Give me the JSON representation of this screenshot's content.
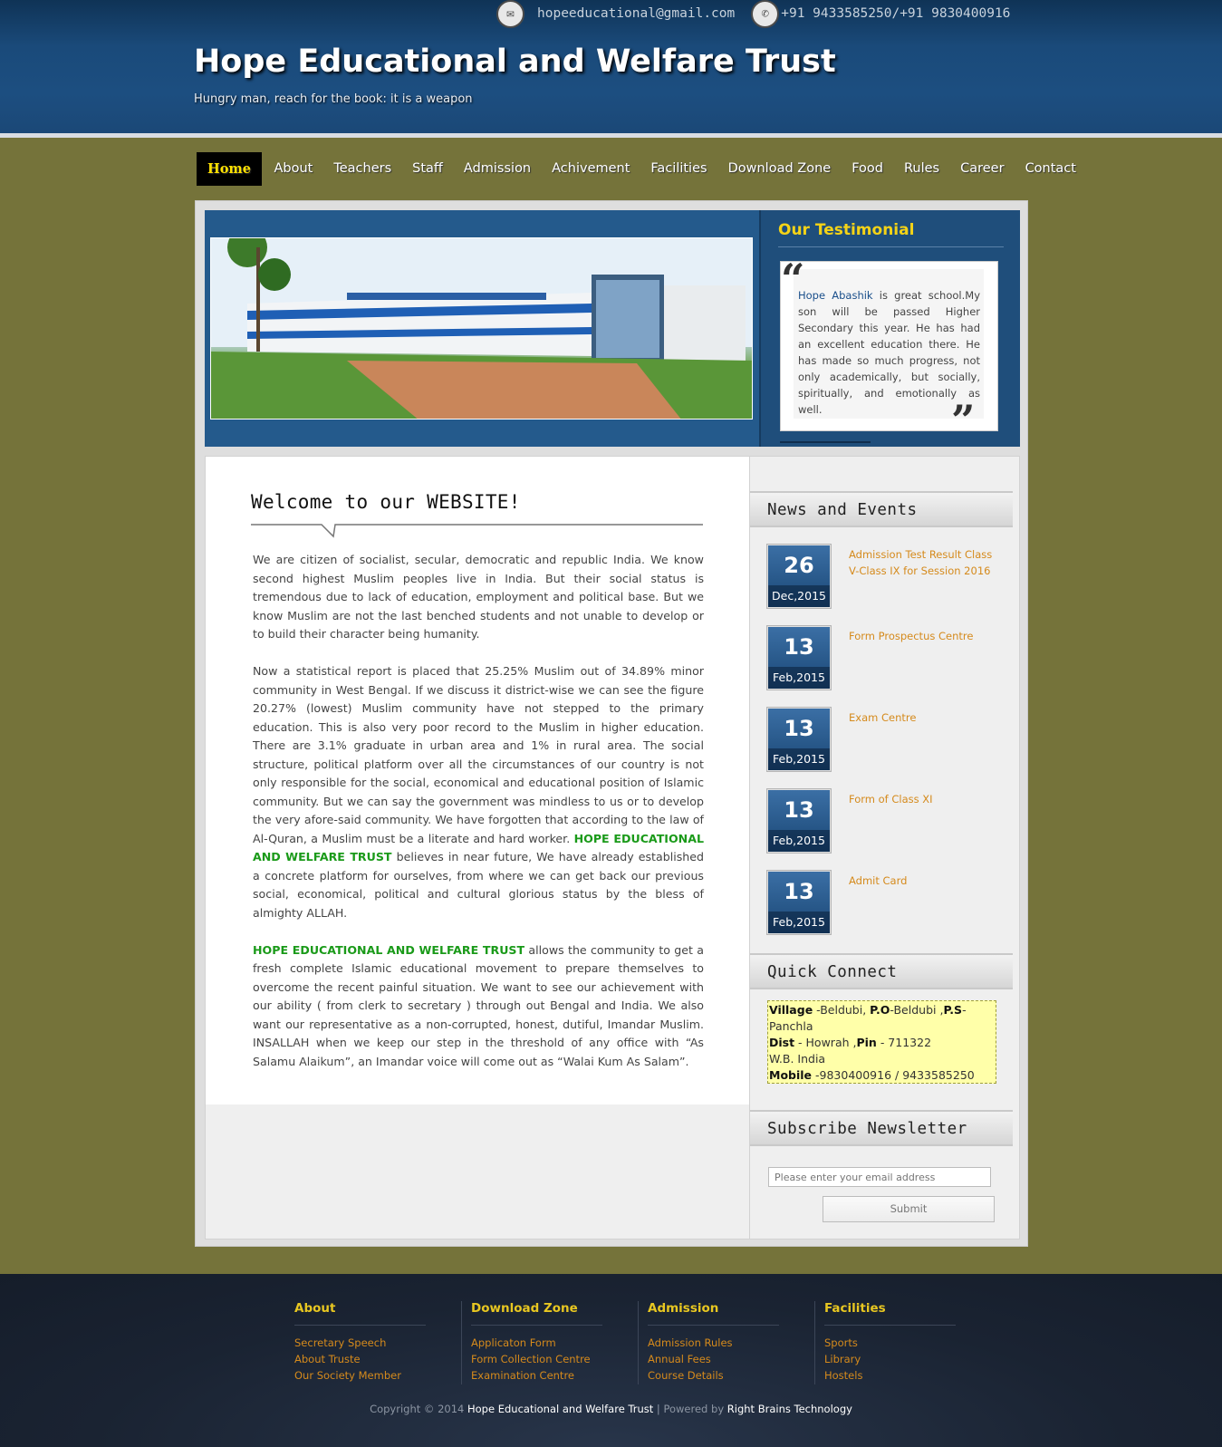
{
  "header": {
    "email": "hopeeducational@gmail.com",
    "phone": "+91 9433585250/+91 9830400916",
    "title": "Hope Educational and Welfare Trust",
    "tagline": "Hungry man, reach for the book: it is a weapon",
    "email_icon": "envelope-icon",
    "phone_icon": "phone-icon"
  },
  "nav": [
    "Home",
    "About",
    "Teachers",
    "Staff",
    "Admission",
    "Achivement",
    "Facilities",
    "Download Zone",
    "Food",
    "Rules",
    "Career",
    "Contact"
  ],
  "testimonial": {
    "title": "Our Testimonial",
    "name": "Hope Abashik",
    "text": " is great school.My son will be passed Higher Secondary this year. He has had an excellent education there. He has made so much progress, not only academically, but socially, spiritually, and emotionally as well."
  },
  "article": {
    "title": "Welcome to our WEBSITE!",
    "p1": "We are citizen of socialist, secular, democratic and republic India. We know second highest Muslim peoples live in India. But their social status is tremendous due to lack of education, employment and political base. But we know Muslim are not the last benched students and not unable to develop or to build their character being humanity.",
    "p2a": "Now a statistical report is placed that 25.25% Muslim out of 34.89% minor community in West Bengal. If we discuss it district-wise we can see the figure 20.27% (lowest) Muslim community have not stepped to the primary education. This is also very poor record to the Muslim in higher education. There are 3.1% graduate in urban area and 1% in rural area. The social structure, political platform over all the circumstances of our country is not only responsible for the social, economical and educational position of Islamic community. But we can say the government was mindless to us or to develop the very afore-said community. We have forgotten that according to the law of Al-Quran, a Muslim must be a literate and hard worker. ",
    "p2b": "HOPE EDUCATIONAL AND WELFARE TRUST",
    "p2c": " believes in near future, We have already established a concrete platform for ourselves, from where we can get back our previous social, economical, political and cultural glorious status by the bless of almighty ALLAH.",
    "p3a": "HOPE EDUCATIONAL AND WELFARE TRUST",
    "p3b": " allows the community to get a fresh complete Islamic educational movement to prepare themselves to overcome the recent painful situation. We want to see our achievement with our ability ( from clerk to secretary ) through out Bengal and India. We also want our representative as a non-corrupted, honest, dutiful, Imandar Muslim. INSALLAH when we keep our step in the threshold of any office with “As Salamu Alaikum”, an Imandar voice will come out as “Walai Kum As Salam”."
  },
  "sidebar": {
    "news_title": "News and Events",
    "news": [
      {
        "day": "26",
        "month": "Dec,2015",
        "title": "Admission Test Result Class V-Class IX for Session 2016"
      },
      {
        "day": "13",
        "month": "Feb,2015",
        "title": "Form Prospectus Centre"
      },
      {
        "day": "13",
        "month": "Feb,2015",
        "title": "Exam Centre"
      },
      {
        "day": "13",
        "month": "Feb,2015",
        "title": "Form of Class XI"
      },
      {
        "day": "13",
        "month": "Feb,2015",
        "title": "Admit Card"
      }
    ],
    "qc_title": "Quick Connect",
    "qc": {
      "village_label": "Village",
      "village": " -Beldubi, ",
      "po_label": "P.O",
      "po": "-Beldubi ,",
      "ps_label": "P.S",
      "ps": "-Panchla",
      "dist_label": "Dist",
      "dist": " - Howrah ,",
      "pin_label": "Pin",
      "pin": " - 711322",
      "state": "W.B. India",
      "mobile_label": "Mobile",
      "mobile": " -9830400916 / 9433585250"
    },
    "nl_title": "Subscribe Newsletter",
    "nl_placeholder": "Please enter your email address",
    "nl_submit": "Submit"
  },
  "footer": {
    "cols": [
      {
        "title": "About",
        "links": [
          "Secretary Speech",
          "About Truste",
          "Our Society Member"
        ]
      },
      {
        "title": "Download Zone",
        "links": [
          "Applicaton Form",
          "Form Collection Centre",
          "Examination Centre"
        ]
      },
      {
        "title": "Admission",
        "links": [
          "Admission Rules",
          "Annual Fees",
          "Course Details"
        ]
      },
      {
        "title": "Facilities",
        "links": [
          "Sports",
          "Library",
          "Hostels"
        ]
      }
    ],
    "copy_prefix": "Copyright © 2014 ",
    "copy_org": "Hope Educational and Welfare Trust",
    "copy_mid": " | Powered by ",
    "copy_by": "Right Brains Technology"
  },
  "colors": {
    "accent": "#f4d317",
    "link": "#d58a1c",
    "green": "#1a9a19",
    "header": "#1c4e80",
    "bg": "#75733a"
  }
}
